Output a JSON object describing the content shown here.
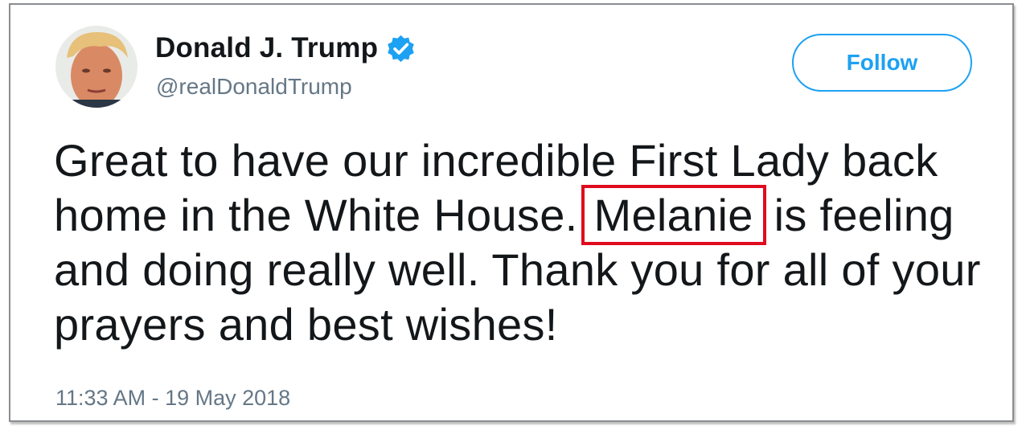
{
  "author": {
    "display_name": "Donald J. Trump",
    "handle": "@realDonaldTrump",
    "verified": true,
    "verified_icon": "verified-badge-icon",
    "avatar": "profile-photo"
  },
  "follow_button": {
    "label": "Follow"
  },
  "tweet": {
    "text_before": "Great to have our incredible First Lady back home in the White House.",
    "highlighted_word": "Melanie",
    "text_after": "is feeling and doing really well. Thank you for all of your prayers and best wishes!",
    "timestamp": "11:33 AM - 19 May 2018"
  },
  "colors": {
    "accent": "#1da1f2",
    "highlight_box": "#e00b1e",
    "text": "#14171a",
    "secondary_text": "#657786"
  }
}
